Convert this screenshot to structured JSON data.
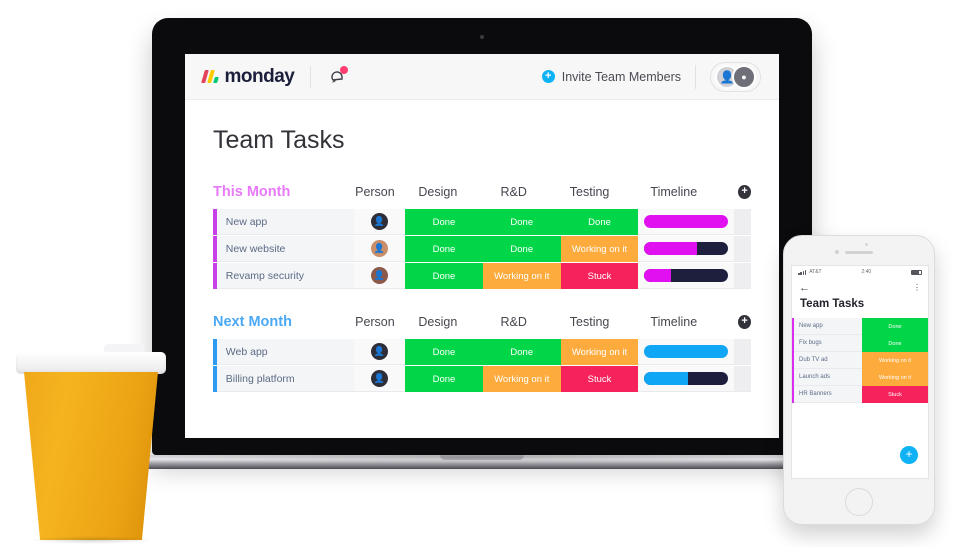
{
  "app": {
    "logo_text": "monday",
    "bell_icon": "notification-bell-icon",
    "invite_label": "Invite Team Members",
    "invite_plus": "+",
    "avatar_primary": "👤",
    "avatar_secondary": "●",
    "page_title": "Team Tasks"
  },
  "colors": {
    "done": "#00d647",
    "working": "#fdab3d",
    "stuck": "#f5225c",
    "timeline_pink": "#e010f0",
    "timeline_blue": "#0fa6f5",
    "timeline_track": "#1e1f3d",
    "group_pink": "#e879f9",
    "group_blue": "#4aa8f5",
    "accent_blue": "#0fb3f5"
  },
  "board": {
    "columns": [
      "Person",
      "Design",
      "R&D",
      "Testing",
      "Timeline"
    ],
    "add_label": "+",
    "groups": [
      {
        "title": "This Month",
        "color_class": "pink",
        "bar_color": "#c940e8",
        "timeline_fill": "#e010f0",
        "rows": [
          {
            "name": "New app",
            "avatar": "👤",
            "avatar_bg": "#2e2e38",
            "statuses": [
              "Done",
              "Done",
              "Done"
            ],
            "timeline_percent": 100
          },
          {
            "name": "New website",
            "avatar": "👤",
            "avatar_bg": "#c98f6a",
            "statuses": [
              "Done",
              "Done",
              "Working on it"
            ],
            "timeline_percent": 63
          },
          {
            "name": "Revamp security",
            "avatar": "👤",
            "avatar_bg": "#8c5a4a",
            "statuses": [
              "Done",
              "Working on it",
              "Stuck"
            ],
            "timeline_percent": 32
          }
        ]
      },
      {
        "title": "Next Month",
        "color_class": "blue",
        "bar_color": "#2e9bf0",
        "timeline_fill": "#0fa6f5",
        "rows": [
          {
            "name": "Web app",
            "avatar": "👤",
            "avatar_bg": "#2e2e38",
            "statuses": [
              "Done",
              "Done",
              "Working on it"
            ],
            "timeline_percent": 100
          },
          {
            "name": "Billing platform",
            "avatar": "👤",
            "avatar_bg": "#2e2e38",
            "statuses": [
              "Done",
              "Working on it",
              "Stuck"
            ],
            "timeline_percent": 52
          }
        ]
      }
    ]
  },
  "phone": {
    "status_bar": {
      "carrier": "AT&T",
      "time": "2:40"
    },
    "back_icon": "back-arrow-icon",
    "menu_icon": "overflow-menu-icon",
    "title": "Team Tasks",
    "fab_label": "+",
    "rows": [
      {
        "name": "New app",
        "status": "Done",
        "bar_color": "#d92ef0"
      },
      {
        "name": "Fix bugs",
        "status": "Done",
        "bar_color": "#d92ef0"
      },
      {
        "name": "Dub TV ad",
        "status": "Working on it",
        "bar_color": "#d92ef0"
      },
      {
        "name": "Launch ads",
        "status": "Working on it",
        "bar_color": "#d92ef0"
      },
      {
        "name": "HR Banners",
        "status": "Stuck",
        "bar_color": "#d92ef0"
      }
    ]
  }
}
